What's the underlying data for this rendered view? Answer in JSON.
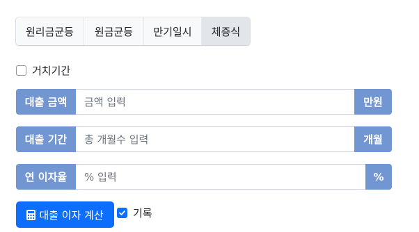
{
  "method_tabs": [
    {
      "label": "원리금균등",
      "active": false
    },
    {
      "label": "원금균등",
      "active": false
    },
    {
      "label": "만기일시",
      "active": false
    },
    {
      "label": "체증식",
      "active": true
    }
  ],
  "grace_period": {
    "label": "거치기간",
    "checked": false
  },
  "loan_amount": {
    "label": "대출 금액",
    "placeholder": "금액 입력",
    "unit": "만원"
  },
  "loan_term": {
    "label": "대출 기간",
    "placeholder": "총 개월수 입력",
    "unit": "개월"
  },
  "interest_rate": {
    "label": "연 이자율",
    "placeholder": "% 입력",
    "unit": "%"
  },
  "calculate_button": {
    "icon": "calculator-icon",
    "label": "대출 이자 계산"
  },
  "record": {
    "label": "기록",
    "checked": true
  },
  "colors": {
    "accent": "#7196d2",
    "primary": "#0d6efd"
  }
}
